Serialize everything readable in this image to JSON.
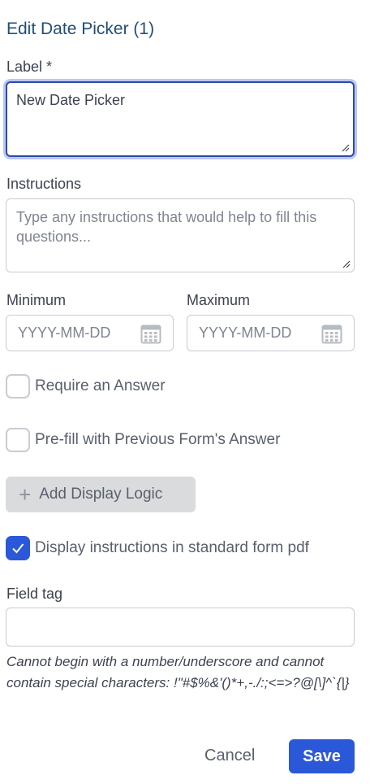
{
  "header": {
    "title": "Edit Date Picker (1)"
  },
  "label_field": {
    "label": "Label *",
    "value": "New Date Picker"
  },
  "instructions_field": {
    "label": "Instructions",
    "placeholder": "Type any instructions that would help to fill this questions..."
  },
  "minimum": {
    "label": "Minimum",
    "placeholder": "YYYY-MM-DD"
  },
  "maximum": {
    "label": "Maximum",
    "placeholder": "YYYY-MM-DD"
  },
  "checkboxes": {
    "require_answer": {
      "label": "Require an Answer",
      "checked": false
    },
    "prefill": {
      "label": "Pre-fill with Previous Form's Answer",
      "checked": false
    },
    "display_instructions": {
      "label": "Display instructions in standard form pdf",
      "checked": true
    }
  },
  "display_logic": {
    "label": "Add Display Logic"
  },
  "field_tag": {
    "label": "Field tag",
    "value": "",
    "hint": "Cannot begin with a number/underscore and cannot contain special characters: !\"#$%&'()*+,-./:;<=>?@[\\]^`{|}"
  },
  "actions": {
    "cancel": "Cancel",
    "save": "Save"
  },
  "colors": {
    "primary": "#2b57d9",
    "title": "#1f4e79",
    "focus_ring": "#b9c7f3"
  }
}
